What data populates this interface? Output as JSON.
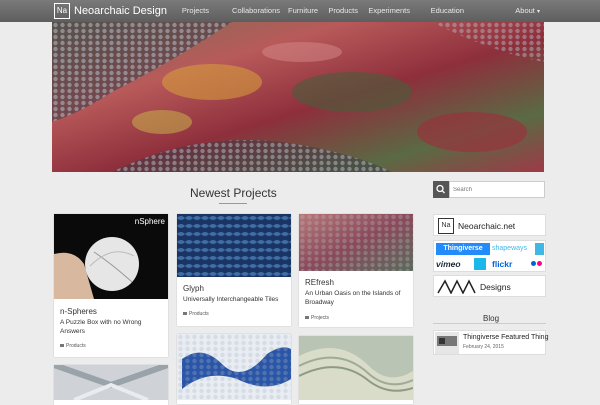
{
  "nav": {
    "logo_symbol": "Na",
    "brand": "Neoarchaic Design",
    "links": [
      "Projects",
      "Collaborations",
      "Furniture",
      "Products",
      "Experiments",
      "Education",
      "About"
    ],
    "about_caret": "▾"
  },
  "section": {
    "title": "Newest Projects"
  },
  "cards": [
    {
      "thumb_label": "nSphere",
      "title": "n-Spheres",
      "subtitle": "A Puzzle Box with no Wrong Answers",
      "tag": "Products"
    },
    {
      "title": "Glyph",
      "subtitle": "Universally Interchangeable Tiles",
      "tag": "Products"
    },
    {
      "title": "REfresh",
      "subtitle": "An Urban Oasis on the Islands of Broadway",
      "tag": "Projects"
    }
  ],
  "sidebar": {
    "search_placeholder": "Search",
    "neoarchaic_link": "Neoarchaic.net",
    "social": {
      "thingiverse": "Thingiverse",
      "shapeways": "shapeways",
      "vimeo": "vimeo",
      "flickr": "flickr"
    },
    "designs_label": "Designs",
    "blog_heading": "Blog",
    "blog_post": {
      "title": "Thingiverse Featured Thing",
      "date": "February 24, 2015"
    }
  },
  "colors": {
    "nav_bg": "#6b6b6b",
    "page_bg": "#ececec",
    "thingiverse_blue": "#248bfb",
    "vimeo_blue": "#1ab7ea",
    "flickr_pink": "#ff0084"
  }
}
